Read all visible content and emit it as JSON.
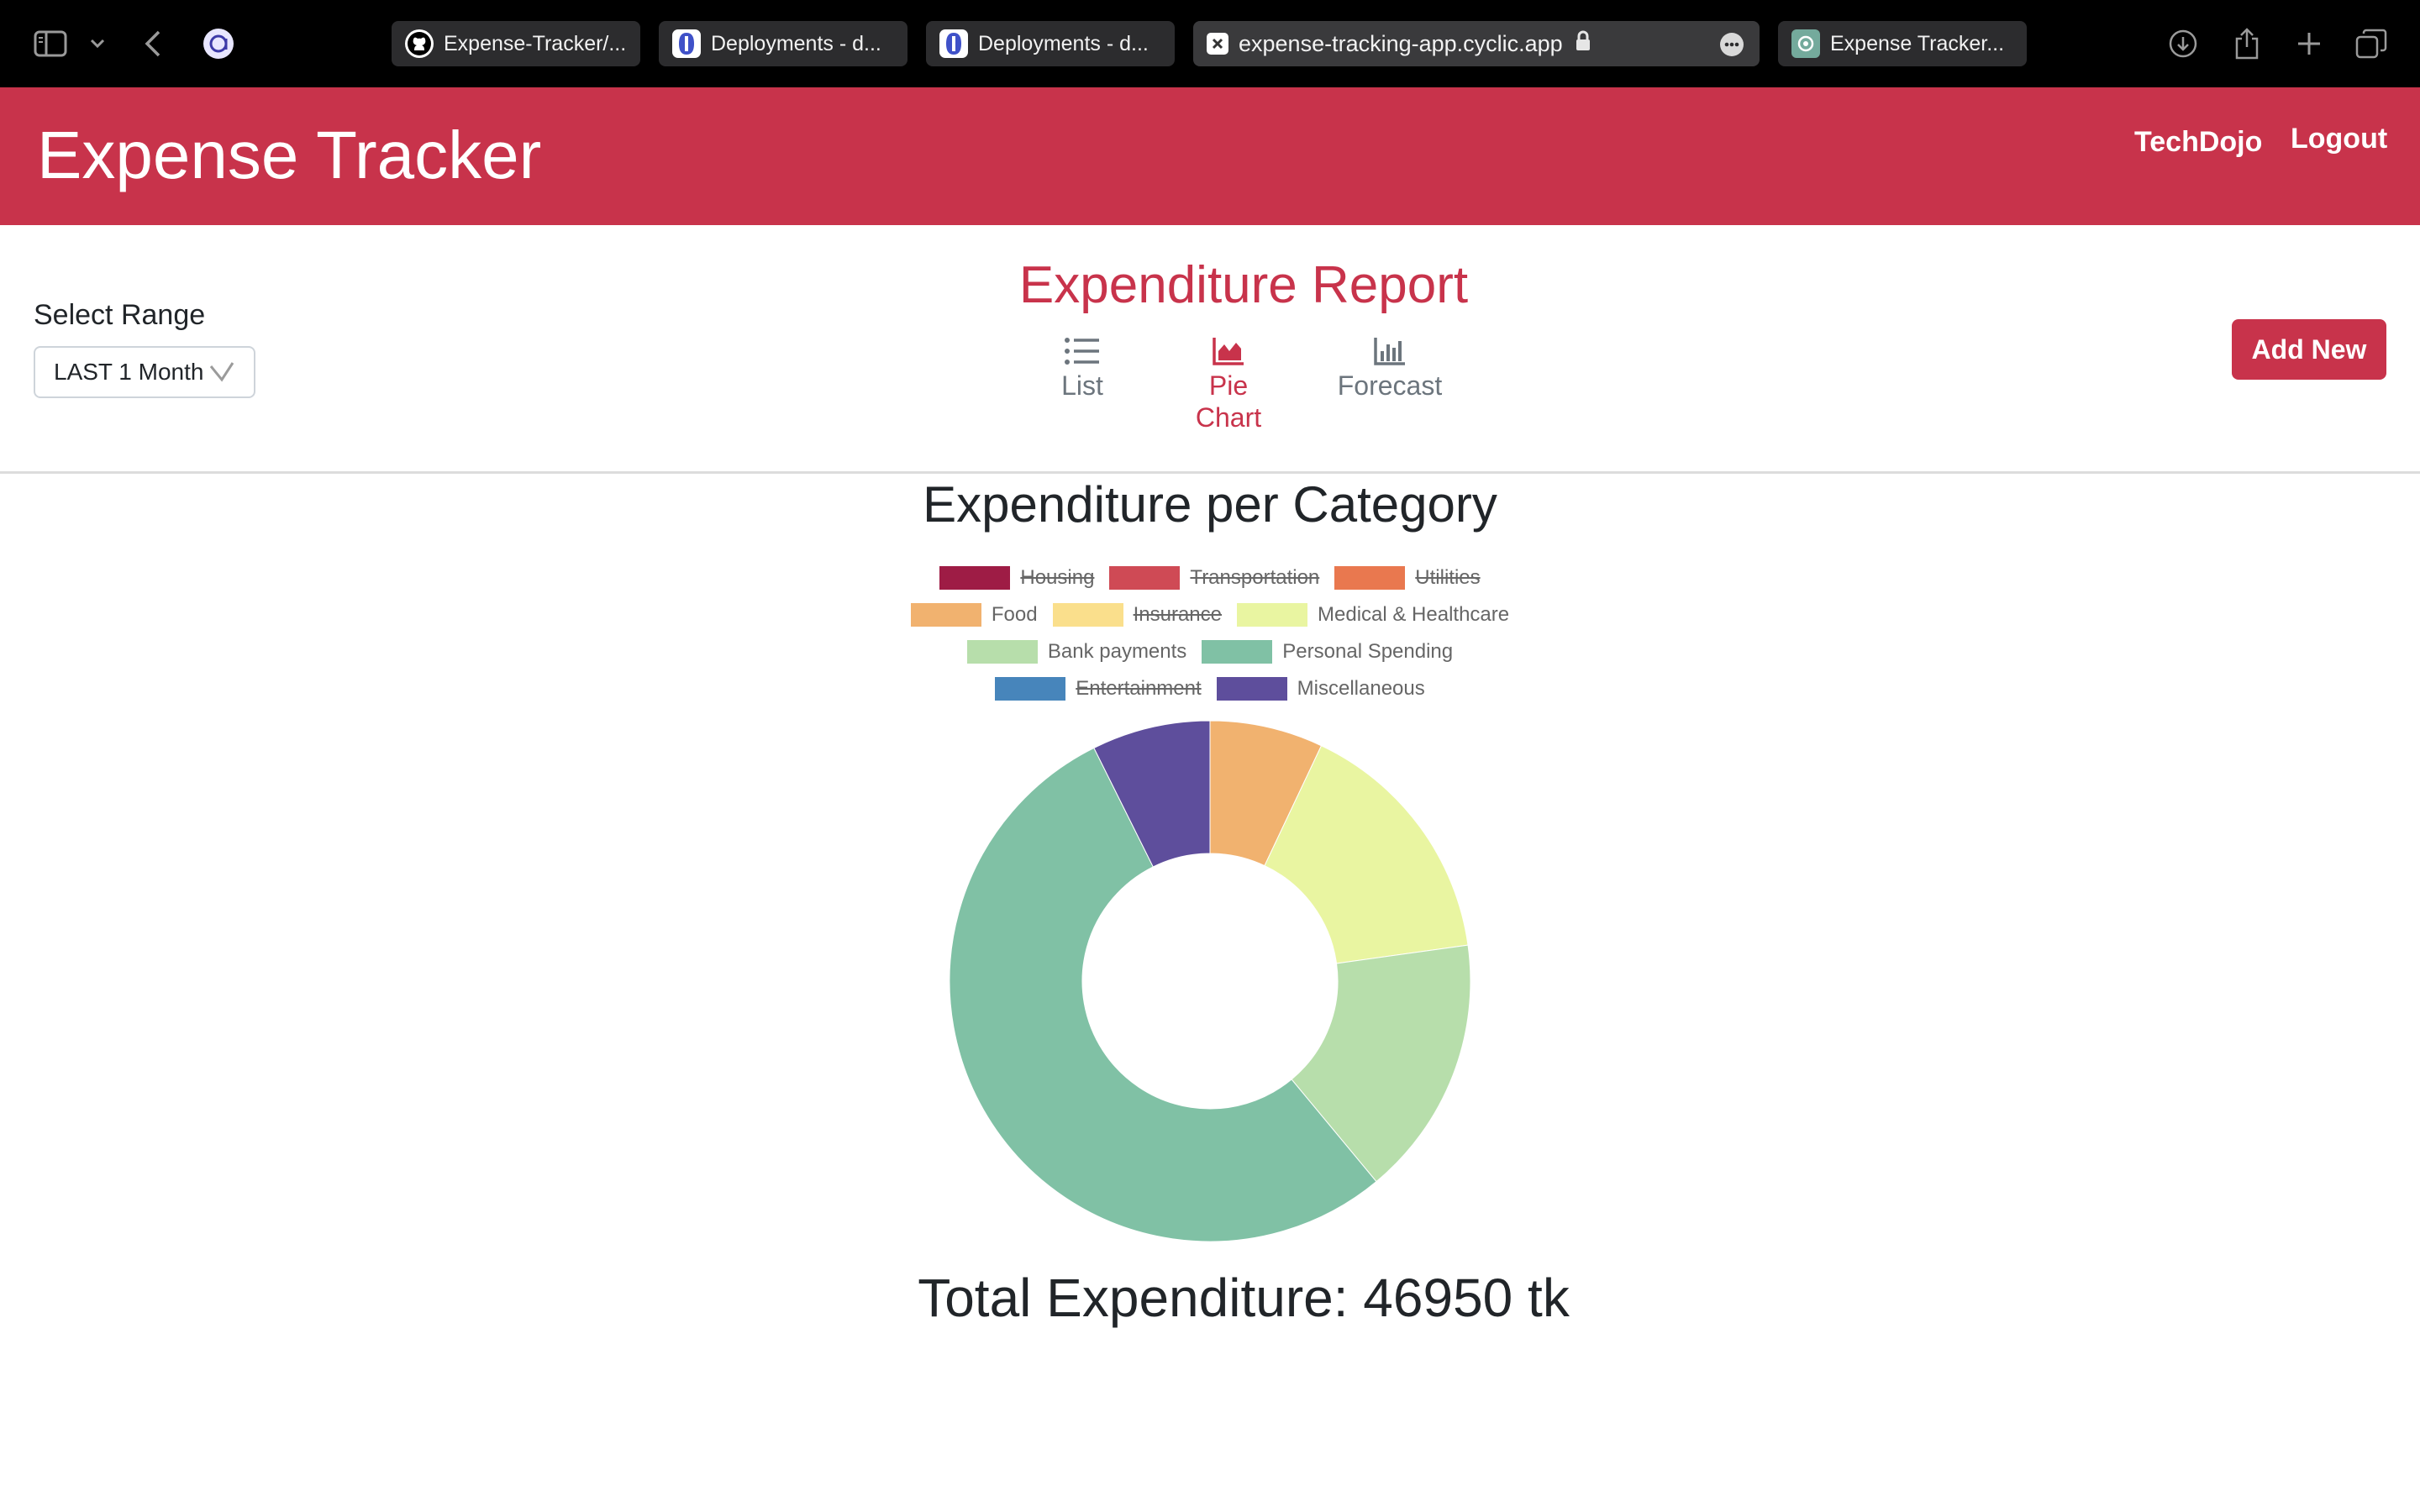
{
  "browser": {
    "tabs": [
      {
        "title": "Expense-Tracker/...",
        "icon": "github-icon"
      },
      {
        "title": "Deployments - d...",
        "icon": "deploy-icon"
      },
      {
        "title": "Deployments - d...",
        "icon": "deploy-icon"
      },
      {
        "title": "expense-tracking-app.cyclic.app",
        "icon": "site-icon",
        "active": true
      },
      {
        "title": "Expense Tracker...",
        "icon": "chatgpt-icon"
      }
    ]
  },
  "header": {
    "brand": "Expense Tracker",
    "user": "TechDojo",
    "logout": "Logout"
  },
  "toolbar": {
    "range_label": "Select Range",
    "range_value": "LAST 1 Month",
    "report_title": "Expenditure Report",
    "views": [
      {
        "label": "List",
        "icon": "list-icon",
        "active": false
      },
      {
        "label": "Pie Chart",
        "icon": "area-chart-icon",
        "active": true
      },
      {
        "label": "Forecast",
        "icon": "bar-chart-icon",
        "active": false
      }
    ],
    "add_button": "Add New"
  },
  "colors": {
    "accent": "#c8334b",
    "browser_bg": "#000000"
  },
  "chart_data": {
    "type": "pie",
    "title": "Expenditure per Category",
    "donut": true,
    "legend_position": "top",
    "categories": [
      "Housing",
      "Transportation",
      "Utilities",
      "Food",
      "Insurance",
      "Medical & Healthcare",
      "Bank payments",
      "Personal Spending",
      "Entertainment",
      "Miscellaneous"
    ],
    "colors": [
      "#9e1c45",
      "#cf4a55",
      "#e9784f",
      "#f1b26f",
      "#fadf8c",
      "#e9f5a1",
      "#b7deab",
      "#80c1a5",
      "#4785bb",
      "#5e4e9c"
    ],
    "hidden": [
      true,
      true,
      true,
      false,
      true,
      false,
      false,
      false,
      true,
      false
    ],
    "values": [
      0,
      0,
      0,
      3300,
      0,
      7400,
      7600,
      25200,
      0,
      3450
    ]
  },
  "total": {
    "label": "Total Expenditure: 46950 tk"
  }
}
